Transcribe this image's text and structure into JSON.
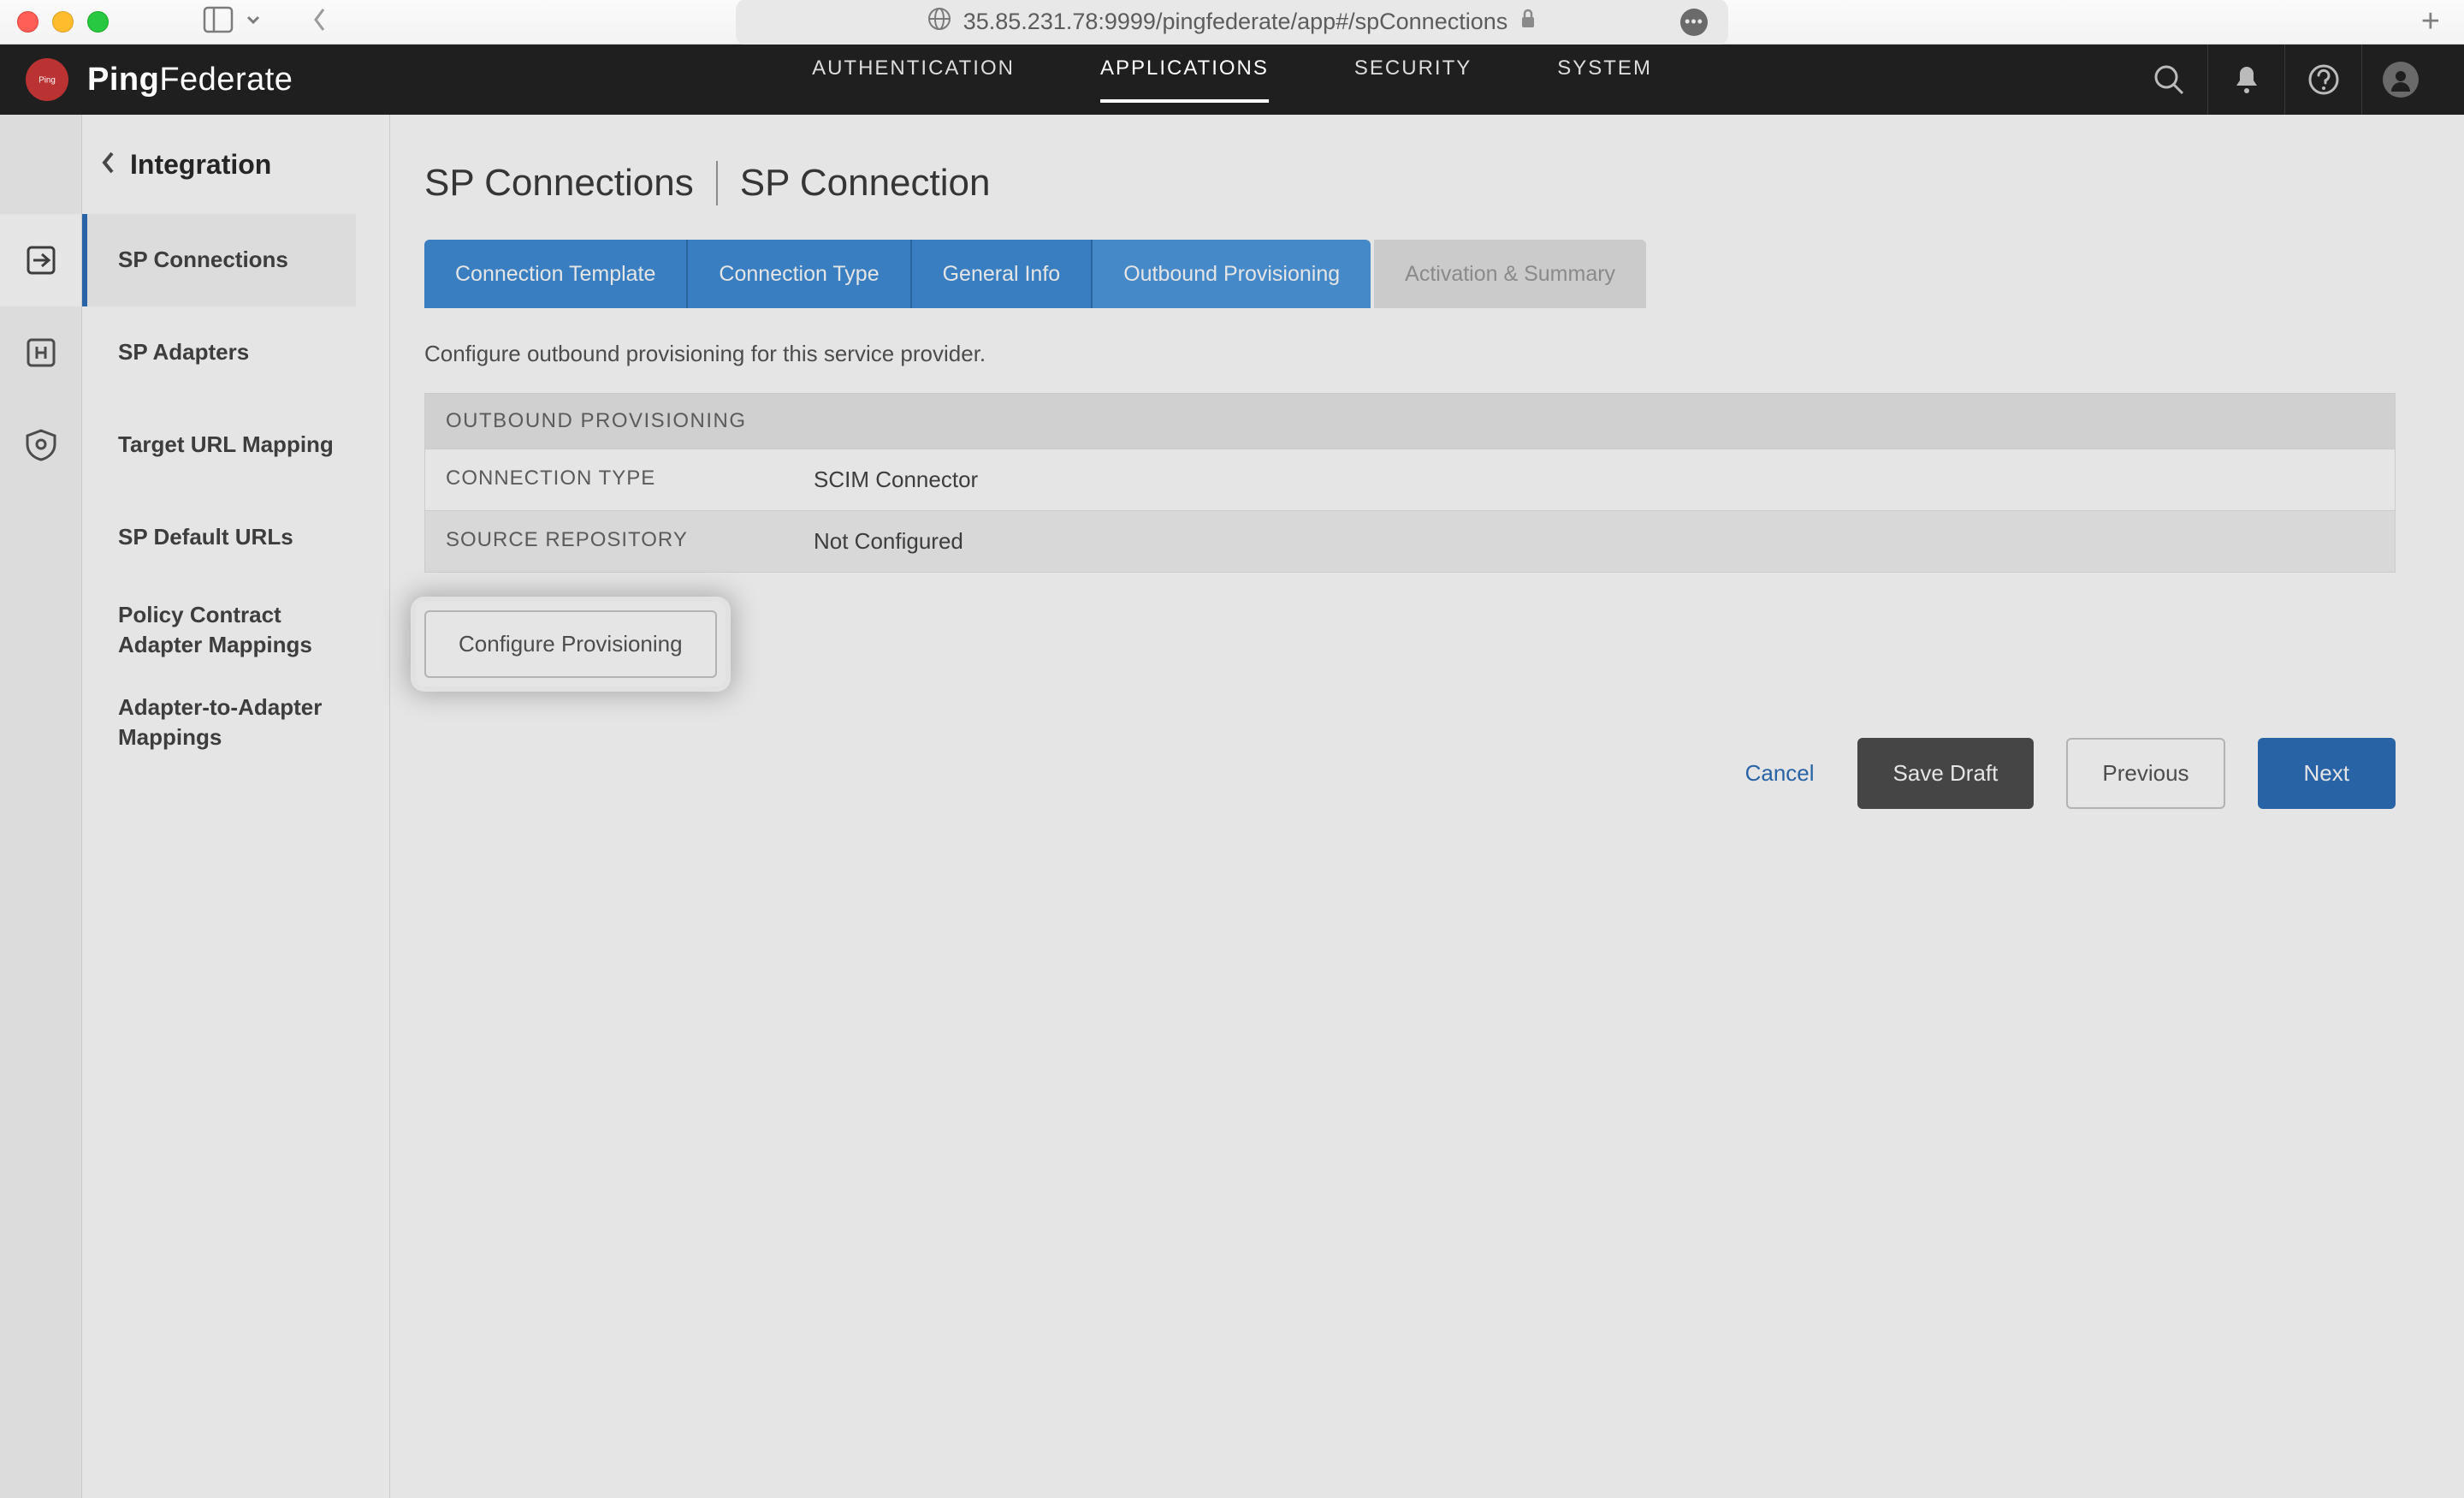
{
  "browser": {
    "url": "35.85.231.78:9999/pingfederate/app#/spConnections"
  },
  "brand": {
    "logo_bold": "Ping",
    "logo_light": "Federate",
    "mark_text": "Ping"
  },
  "top_nav": {
    "items": [
      "AUTHENTICATION",
      "APPLICATIONS",
      "SECURITY",
      "SYSTEM"
    ],
    "active_index": 1
  },
  "sidebar": {
    "title": "Integration",
    "items": [
      "SP Connections",
      "SP Adapters",
      "Target URL Mapping",
      "SP Default URLs",
      "Policy Contract Adapter Mappings",
      "Adapter-to-Adapter Mappings"
    ],
    "active_index": 0
  },
  "breadcrumb": {
    "parent": "SP Connections",
    "current": "SP Connection"
  },
  "wizard": {
    "tabs": [
      "Connection Template",
      "Connection Type",
      "General Info",
      "Outbound Provisioning",
      "Activation & Summary"
    ],
    "active_index": 3,
    "disabled_index": 4
  },
  "content": {
    "description": "Configure outbound provisioning for this service provider.",
    "section_header": "OUTBOUND PROVISIONING",
    "rows": [
      {
        "label": "CONNECTION TYPE",
        "value": "SCIM Connector"
      },
      {
        "label": "SOURCE REPOSITORY",
        "value": "Not Configured"
      }
    ],
    "configure_button": "Configure Provisioning"
  },
  "actions": {
    "cancel": "Cancel",
    "save_draft": "Save Draft",
    "previous": "Previous",
    "next": "Next"
  }
}
